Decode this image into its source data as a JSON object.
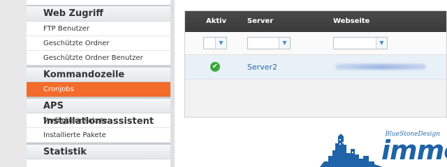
{
  "sidebar": {
    "sections": [
      {
        "title": "Web Zugriff",
        "items": [
          {
            "label": "FTP Benutzer",
            "active": false
          },
          {
            "label": "Geschützte Ordner",
            "active": false
          },
          {
            "label": "Geschützte Ordner Benutzer",
            "active": false
          }
        ]
      },
      {
        "title": "Kommandozeile",
        "items": [
          {
            "label": "Cronjobs",
            "active": true
          }
        ]
      },
      {
        "title": "APS Installationsassistent",
        "items": [
          {
            "label": "Verfügbare Pakete",
            "active": false
          },
          {
            "label": "Installierte Pakete",
            "active": false
          }
        ]
      },
      {
        "title": "Statistik",
        "items": []
      }
    ]
  },
  "grid": {
    "columns": [
      "Aktiv",
      "Server",
      "Webseite"
    ],
    "rows": [
      {
        "aktiv": "✔",
        "server": "Server2",
        "webseite": ""
      }
    ],
    "filter_arrow": "▼"
  },
  "logo": {
    "subtitle": "BlueStoneDesign",
    "word": "immo"
  },
  "colors": {
    "accent": "#f26b2b",
    "grid_header": "#404040",
    "link": "#2a6aa0",
    "logo": "#1f63a8"
  }
}
